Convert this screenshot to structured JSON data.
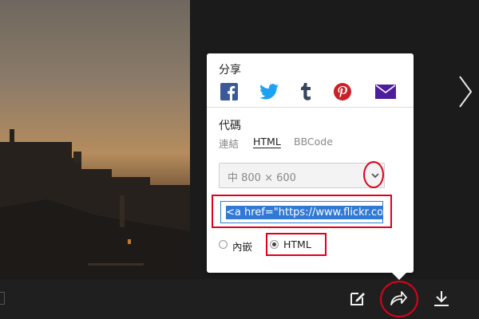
{
  "share": {
    "title": "分享",
    "icons": [
      "facebook-icon",
      "twitter-icon",
      "tumblr-icon",
      "pinterest-icon",
      "email-icon"
    ],
    "colors": {
      "facebook": "#3b5998",
      "twitter": "#1da1f2",
      "tumblr": "#36465d",
      "pinterest": "#cb2027",
      "email": "#4e1d9c"
    }
  },
  "code": {
    "title": "代碼",
    "tabs": [
      "連結",
      "HTML",
      "BBCode"
    ],
    "active_tab": "HTML",
    "size_select": {
      "value": "中 800 × 600"
    },
    "field_value": "<a href=\"https://www.flickr.co",
    "radios": [
      {
        "label": "內嵌",
        "checked": false
      },
      {
        "label": "HTML",
        "checked": true
      }
    ]
  },
  "toolbar": {
    "icons": [
      "edit-icon",
      "share-icon",
      "download-icon"
    ]
  },
  "viewer": {
    "next_icon": "chevron-right-icon"
  },
  "theme": {
    "highlight": "#e0001b",
    "selection": "#3079d6",
    "focus": "#2f80d1"
  }
}
